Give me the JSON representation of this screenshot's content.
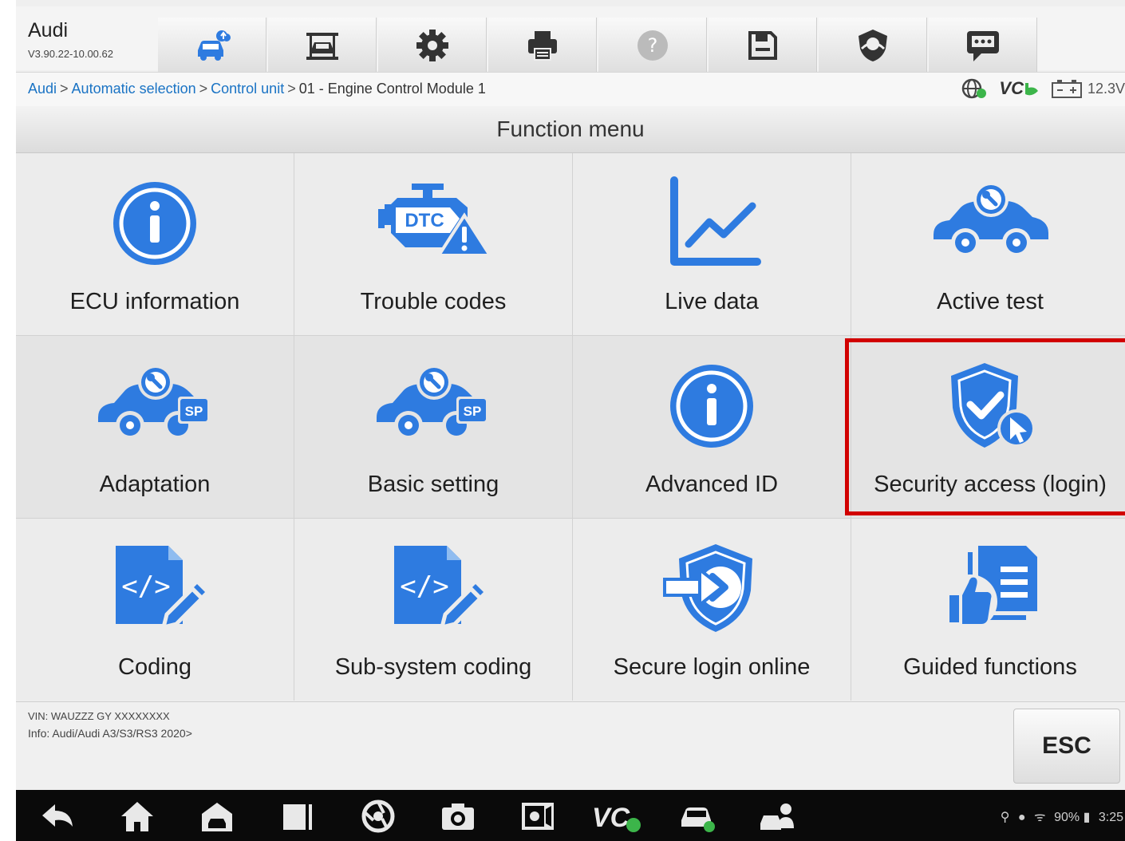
{
  "header": {
    "title": "Audi",
    "version": "V3.90.22-10.00.62",
    "toolbar": [
      {
        "name": "car-cloud-icon"
      },
      {
        "name": "car-lift-icon"
      },
      {
        "name": "settings-gear-icon"
      },
      {
        "name": "printer-icon"
      },
      {
        "name": "help-icon"
      },
      {
        "name": "save-icon"
      },
      {
        "name": "shield-support-icon"
      },
      {
        "name": "message-icon"
      }
    ]
  },
  "breadcrumb": {
    "items": [
      "Audi",
      "Automatic selection",
      "Control unit",
      "01 - Engine Control Module 1"
    ],
    "separator": ">"
  },
  "status": {
    "vci": "VC",
    "battery": "12.3V"
  },
  "section_title": "Function menu",
  "tiles": [
    {
      "label": "ECU information",
      "icon": "info-circle-icon"
    },
    {
      "label": "Trouble codes",
      "icon": "dtc-engine-icon"
    },
    {
      "label": "Live data",
      "icon": "line-chart-icon"
    },
    {
      "label": "Active test",
      "icon": "car-wrench-icon"
    },
    {
      "label": "Adaptation",
      "icon": "car-wrench-sp-icon"
    },
    {
      "label": "Basic setting",
      "icon": "car-wrench-sp-icon"
    },
    {
      "label": "Advanced ID",
      "icon": "info-circle-icon"
    },
    {
      "label": "Security access (login)",
      "icon": "shield-check-cursor-icon",
      "highlighted": true
    },
    {
      "label": "Coding",
      "icon": "code-edit-icon"
    },
    {
      "label": "Sub-system coding",
      "icon": "code-edit-icon"
    },
    {
      "label": "Secure login online",
      "icon": "shield-arrow-icon"
    },
    {
      "label": "Guided functions",
      "icon": "hand-document-icon"
    }
  ],
  "footer": {
    "vin": "VIN: WAUZZZ GY XXXXXXXX",
    "info": "Info: Audi/Audi A3/S3/RS3 2020>",
    "esc_label": "ESC"
  },
  "system_bar": {
    "battery_percent": "90%",
    "time": "3:25"
  },
  "colors": {
    "icon_blue": "#2e7be0",
    "highlight_red": "#d10000",
    "link_blue": "#1a73c4"
  }
}
